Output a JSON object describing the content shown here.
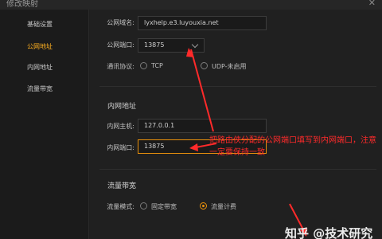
{
  "window": {
    "title": "修改映射",
    "close_glyph": "✕"
  },
  "sidebar": {
    "items": [
      {
        "label": "基础设置",
        "active": false
      },
      {
        "label": "公网地址",
        "active": true
      },
      {
        "label": "内网地址",
        "active": false
      },
      {
        "label": "流量带宽",
        "active": false
      }
    ]
  },
  "public": {
    "domain_label": "公网域名:",
    "domain_value": "lyxhelp.e3.luyouxia.net",
    "port_label": "公网端口:",
    "port_value": "13875",
    "protocol_label": "通讯协议:",
    "protocol_options": [
      {
        "label": "TCP",
        "selected": false
      },
      {
        "label": "UDP-未启用",
        "selected": false
      }
    ]
  },
  "internal": {
    "section_title": "内网地址",
    "host_label": "内网主机:",
    "host_value": "127.0.0.1",
    "port_label": "内网端口:",
    "port_value": "13875"
  },
  "bandwidth": {
    "section_title": "流量带宽",
    "mode_label": "流量模式:",
    "options": [
      {
        "label": "固定带宽",
        "selected": false
      },
      {
        "label": "流量计费",
        "selected": true
      }
    ]
  },
  "annotation": {
    "text": "把路由侠分配的公网端口填写到内网端口，注意一定要保持一致",
    "color": "#ff2a2a"
  },
  "watermark": {
    "text": "知乎 @技术研究"
  },
  "colors": {
    "accent": "#e8900c",
    "annotation": "#ff2a2a",
    "background": "#1f1f1f"
  }
}
